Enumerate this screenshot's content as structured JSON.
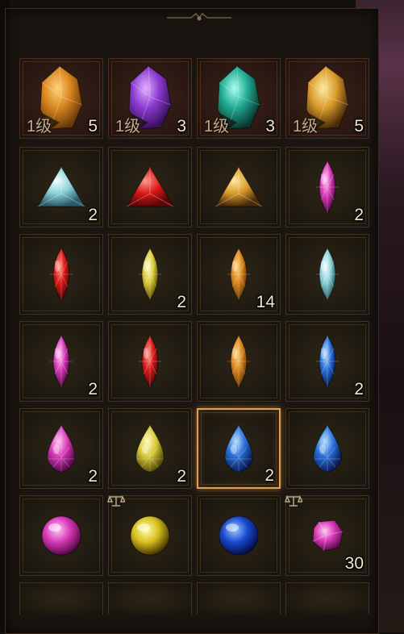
{
  "colors": {
    "panel_bg": "#1b1511",
    "slot_border": "#3e3322",
    "selected_border": "#e0a050",
    "count_text": "#f2e6cf"
  },
  "inventory": {
    "rows": [
      [
        {
          "item": "amber-ore-icon",
          "level": "1级",
          "count": "5"
        },
        {
          "item": "amethyst-ore-icon",
          "level": "1级",
          "count": "3"
        },
        {
          "item": "emerald-ore-icon",
          "level": "1级",
          "count": "3"
        },
        {
          "item": "topaz-ore-icon",
          "level": "1级",
          "count": "5"
        }
      ],
      [
        {
          "item": "diamond-triangle-gem-icon",
          "count": "2"
        },
        {
          "item": "ruby-triangle-gem-icon",
          "count": ""
        },
        {
          "item": "topaz-triangle-gem-icon",
          "count": ""
        },
        {
          "item": "pink-marquise-gem-icon",
          "count": "2"
        }
      ],
      [
        {
          "item": "ruby-marquise-gem-icon",
          "count": ""
        },
        {
          "item": "citrine-marquise-gem-icon",
          "count": "2"
        },
        {
          "item": "amber-marquise-gem-icon",
          "count": "14"
        },
        {
          "item": "diamond-marquise-gem-icon",
          "count": ""
        }
      ],
      [
        {
          "item": "pink-marquise-gem-icon",
          "count": "2"
        },
        {
          "item": "ruby-marquise-gem-icon",
          "count": ""
        },
        {
          "item": "amber-marquise-gem-icon",
          "count": ""
        },
        {
          "item": "sapphire-marquise-gem-icon",
          "count": "2"
        }
      ],
      [
        {
          "item": "pink-teardrop-gem-icon",
          "count": "2"
        },
        {
          "item": "citrine-teardrop-gem-icon",
          "count": "2"
        },
        {
          "item": "sapphire-teardrop-gem-icon",
          "count": "2",
          "selected": true
        },
        {
          "item": "sapphire-teardrop-gem-icon",
          "count": ""
        }
      ],
      [
        {
          "item": "pink-orb-icon",
          "count": ""
        },
        {
          "item": "gold-orb-icon",
          "count": "",
          "bound": true
        },
        {
          "item": "blue-orb-icon",
          "count": ""
        },
        {
          "item": "pink-rough-stone-icon",
          "count": "30",
          "bound": true
        }
      ]
    ]
  }
}
